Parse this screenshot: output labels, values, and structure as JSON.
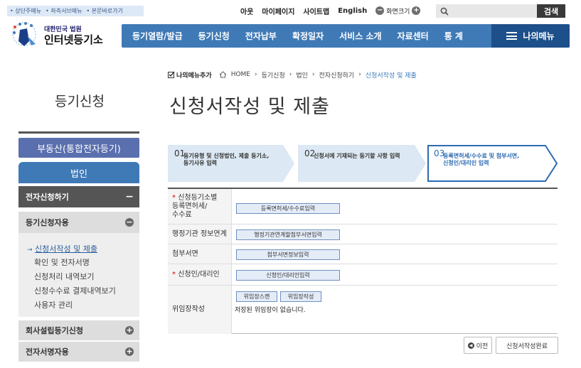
{
  "skip_links": [
    "상단주메뉴",
    "좌측서브메뉴",
    "본문바로가기"
  ],
  "utils": {
    "logout": "아웃",
    "mypage": "마이페이지",
    "sitemap": "사이트맵",
    "english": "English",
    "zoom_label": "화면크기",
    "zoom_out": "−",
    "zoom_in": "+"
  },
  "search": {
    "placeholder": "",
    "button": "검색"
  },
  "logo": {
    "line1": "대한민국 법원",
    "line2": "인터넷등기소"
  },
  "gnb": {
    "items": [
      "등기열람/발급",
      "등기신청",
      "전자납부",
      "확정일자",
      "서비스 소개",
      "자료센터",
      "통 계"
    ],
    "mymenu": "나의메뉴"
  },
  "side": {
    "title": "등기신청",
    "btn_realestate": "부동산(통합전자등기)",
    "btn_corp": "법인",
    "sec_esign": "전자신청하기",
    "sec_esign_toggle": "−",
    "sec_regapp": "등기신청자용",
    "sec_regapp_toggle": "−",
    "sub_items": [
      "신청서작성 및 제출",
      "확인 및 전자서명",
      "신청처리 내역보기",
      "신청수수료 결제내역보기",
      "사용자 관리"
    ],
    "sub_marker": "→",
    "sec_company": "회사설립등기신청",
    "sec_company_toggle": "+",
    "sec_esig_user": "전자서명자용",
    "sec_esig_user_toggle": "+"
  },
  "crumb": {
    "fav": "나의메뉴추가",
    "home": "HOME",
    "path": [
      "등기신청",
      "법인",
      "전자신청하기",
      "신청서작성 및 제출"
    ]
  },
  "page_title": "신청서작성 및 제출",
  "steps": [
    {
      "num": "01",
      "text1": "등기유형 및 신청법인, 제출 등기소,",
      "text2": "등기사유 입력"
    },
    {
      "num": "02",
      "text1": "신청서에 기재되는 등기할 사항 입력",
      "text2": ""
    },
    {
      "num": "03",
      "text1": "등록면허세/수수료 및 첨부서면,",
      "text2": "신청인/대리인 입력"
    }
  ],
  "form": {
    "rows": [
      {
        "star": "*",
        "label1": "신청등기소별",
        "label2": "등록면허세/",
        "label3": "수수료",
        "button": "등록면허세/수수료입력"
      },
      {
        "star": "",
        "label1": "행정기관 정보연계",
        "button": "행정기관연계할첨부서면입력"
      },
      {
        "star": "",
        "label1": "첨부서면",
        "button": "첨부서면정보입력"
      },
      {
        "star": "*",
        "label1": "신청인/대리인",
        "button": "신청인/대리인입력"
      },
      {
        "star": "",
        "label1": "위임장작성",
        "button": "위임장스캔",
        "button2": "위임장작성",
        "note": "저장된 위임장이 없습니다."
      }
    ]
  },
  "footer": {
    "prev": "이전",
    "done": "신청서작성완료"
  },
  "colors": {
    "primary": "#3f7ab7",
    "dark_nav": "#1d4f8a",
    "side_btn": "#5a6fae",
    "step_bg": "#dce8f3",
    "step_active": "#2c6bb3"
  }
}
